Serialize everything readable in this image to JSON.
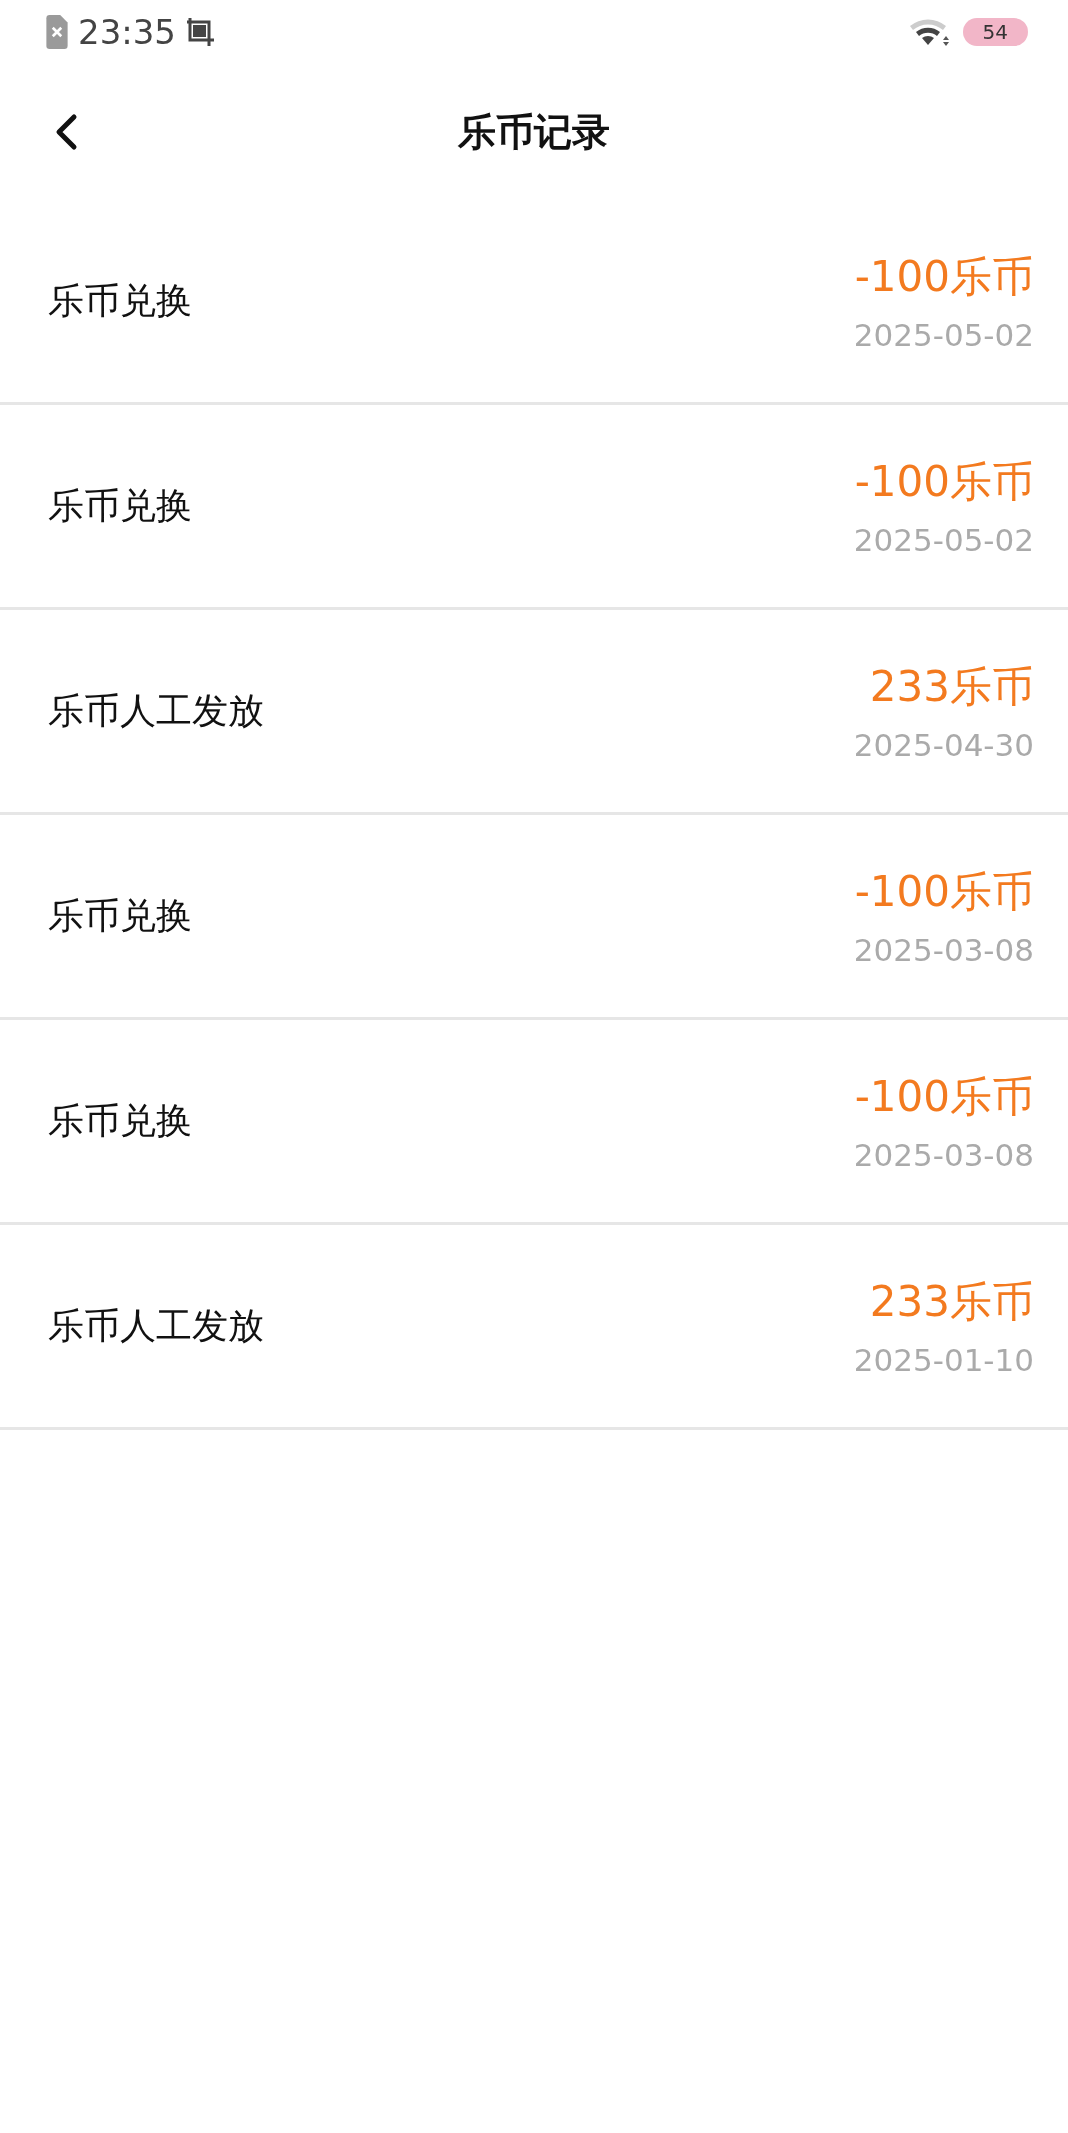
{
  "status_bar": {
    "time": "23:35",
    "battery": "54"
  },
  "header": {
    "title": "乐币记录"
  },
  "records": [
    {
      "title": "乐币兑换",
      "amount": "-100乐币",
      "date": "2025-05-02"
    },
    {
      "title": "乐币兑换",
      "amount": "-100乐币",
      "date": "2025-05-02"
    },
    {
      "title": "乐币人工发放",
      "amount": "233乐币",
      "date": "2025-04-30"
    },
    {
      "title": "乐币兑换",
      "amount": "-100乐币",
      "date": "2025-03-08"
    },
    {
      "title": "乐币兑换",
      "amount": "-100乐币",
      "date": "2025-03-08"
    },
    {
      "title": "乐币人工发放",
      "amount": "233乐币",
      "date": "2025-01-10"
    }
  ]
}
